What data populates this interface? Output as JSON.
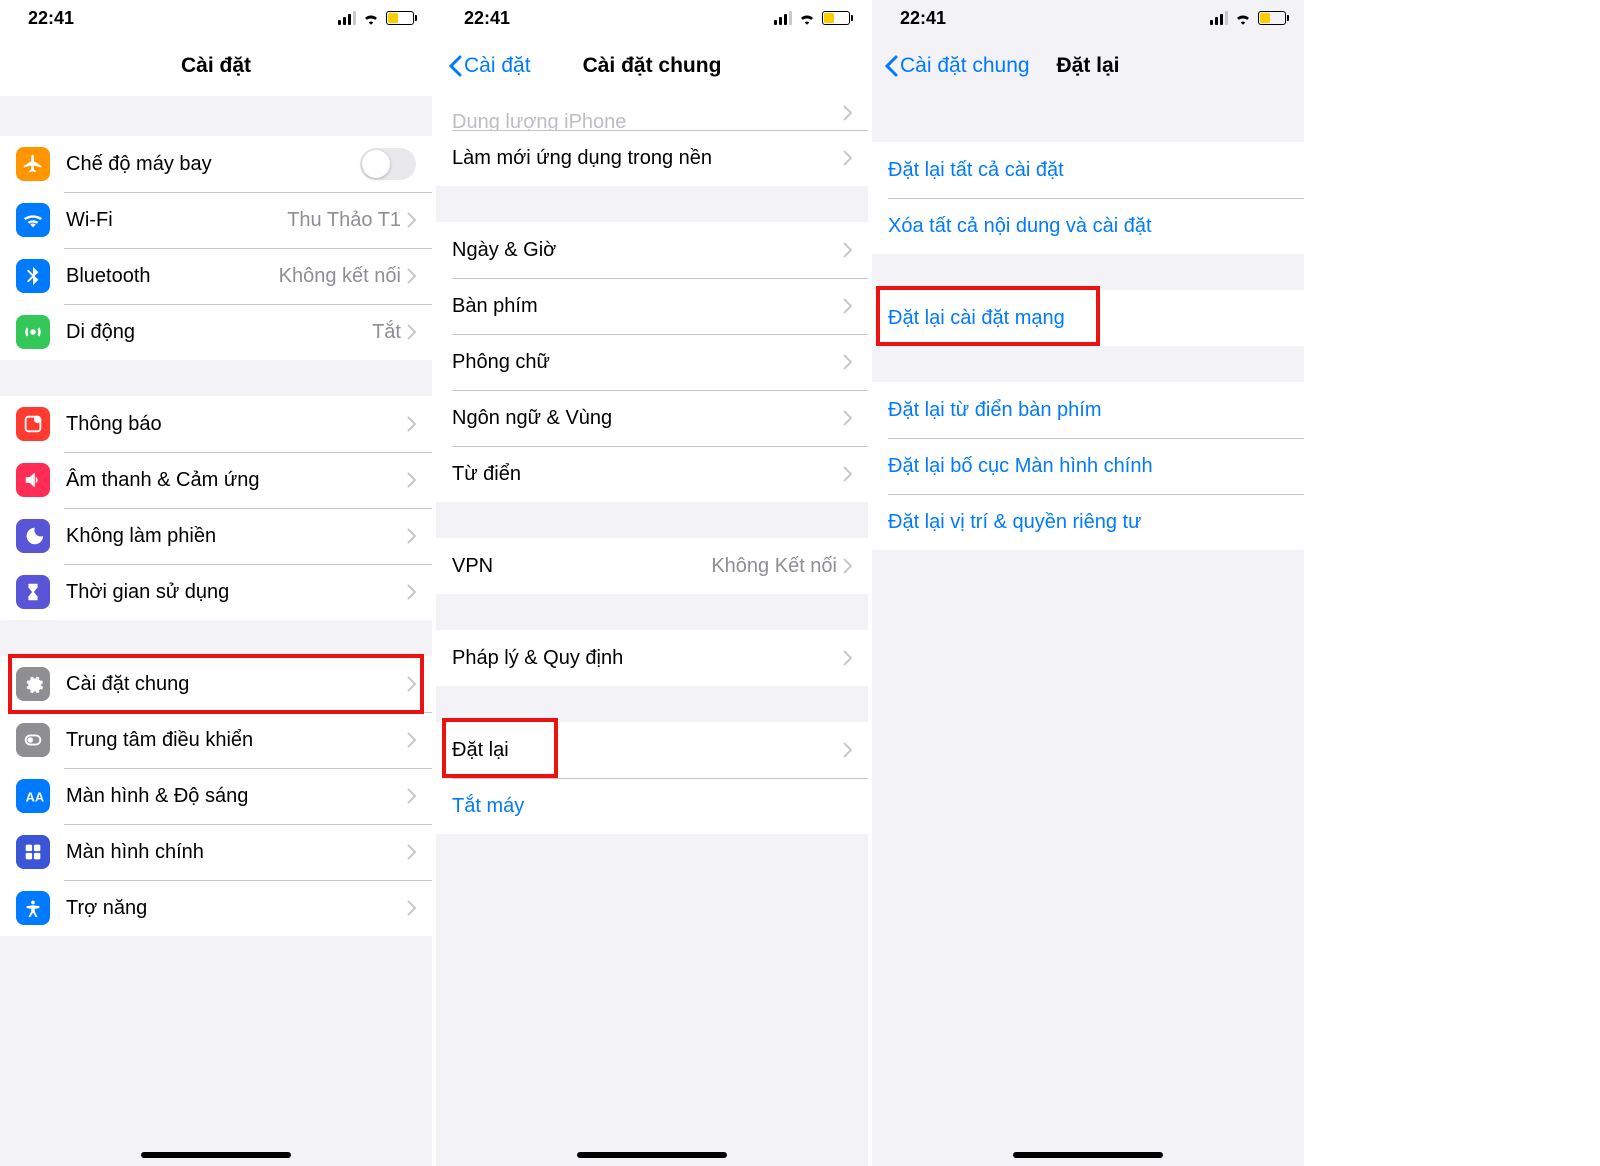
{
  "status": {
    "time": "22:41"
  },
  "screen1": {
    "title": "Cài đặt",
    "g1": [
      {
        "icon": "airplane",
        "label": "Chế độ máy bay",
        "type": "toggle"
      },
      {
        "icon": "wifi",
        "label": "Wi-Fi",
        "value": "Thu Thảo T1"
      },
      {
        "icon": "bluetooth",
        "label": "Bluetooth",
        "value": "Không kết nối"
      },
      {
        "icon": "cellular",
        "label": "Di động",
        "value": "Tắt"
      }
    ],
    "g2": [
      {
        "icon": "notify",
        "label": "Thông báo"
      },
      {
        "icon": "sound",
        "label": "Âm thanh & Cảm ứng"
      },
      {
        "icon": "dnd",
        "label": "Không làm phiền"
      },
      {
        "icon": "screentime",
        "label": "Thời gian sử dụng"
      }
    ],
    "g3": [
      {
        "icon": "general",
        "label": "Cài đặt chung",
        "highlight": true
      },
      {
        "icon": "control",
        "label": "Trung tâm điều khiển"
      },
      {
        "icon": "display",
        "label": "Màn hình & Độ sáng"
      },
      {
        "icon": "home",
        "label": "Màn hình chính"
      },
      {
        "icon": "access",
        "label": "Trợ năng"
      }
    ]
  },
  "screen2": {
    "back": "Cài đặt",
    "title": "Cài đặt chung",
    "cut_label": "Dung lượng iPhone",
    "r0": {
      "label": "Làm mới ứng dụng trong nền"
    },
    "g1": [
      {
        "label": "Ngày & Giờ"
      },
      {
        "label": "Bàn phím"
      },
      {
        "label": "Phông chữ"
      },
      {
        "label": "Ngôn ngữ & Vùng"
      },
      {
        "label": "Từ điển"
      }
    ],
    "g2": [
      {
        "label": "VPN",
        "value": "Không Kết nối"
      }
    ],
    "g3": [
      {
        "label": "Pháp lý & Quy định"
      }
    ],
    "g4": [
      {
        "label": "Đặt lại",
        "highlight": true
      },
      {
        "label": "Tắt máy",
        "link": true
      }
    ]
  },
  "screen3": {
    "back": "Cài đặt chung",
    "title": "Đặt lại",
    "g1": [
      {
        "label": "Đặt lại tất cả cài đặt"
      },
      {
        "label": "Xóa tất cả nội dung và cài đặt"
      }
    ],
    "g2": [
      {
        "label": "Đặt lại cài đặt mạng",
        "highlight": true
      }
    ],
    "g3": [
      {
        "label": "Đặt lại từ điển bàn phím"
      },
      {
        "label": "Đặt lại bố cục Màn hình chính"
      },
      {
        "label": "Đặt lại vị trí & quyền riêng tư"
      }
    ]
  }
}
